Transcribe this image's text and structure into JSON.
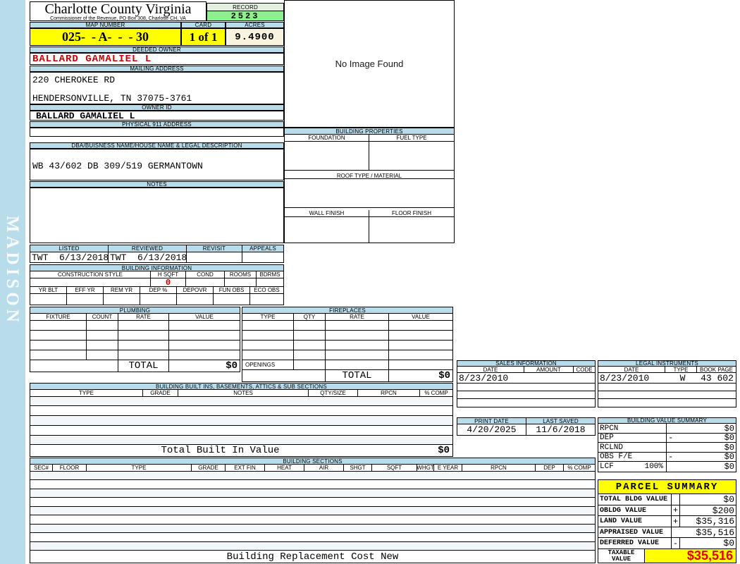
{
  "colors": {
    "header_bar_blue": "#b9dcea",
    "record_green": "#90ee90",
    "highlight_yellow": "#ffff00",
    "acres_cream": "#f7f3df",
    "alert_red": "#cc0000"
  },
  "watermark": "MADISON",
  "header": {
    "county": "Charlotte County Virginia",
    "commissioner": "Commissioner of the Revenue, PO Box 308, Charlotte CH, VA",
    "record_label": "RECORD",
    "record": "2523",
    "map_label": "MAP NUMBER",
    "map": "025-  - A-  -  - 30",
    "card_label": "CARD",
    "card": "1 of 1",
    "acres_label": "ACRES",
    "acres": "9.4900"
  },
  "image_box": {
    "text": "No Image Found"
  },
  "owner": {
    "deeded_label": "DEEDED OWNER",
    "deeded": "BALLARD GAMALIEL L",
    "mailing_label": "MAILING ADDRESS",
    "address1": "220 CHEROKEE RD",
    "address2": "HENDERSONVILLE, TN 37075-3761",
    "owner_id_label": "OWNER ID",
    "owner_id": "BALLARD GAMALIEL L",
    "physical_label": "PHYSICAL 911 ADDRESS",
    "physical": ""
  },
  "dba": {
    "label": "DBA/BUISNESS NAME/HOUSE NAME & LEGAL DESCRIPTION",
    "value": "WB 43/602 DB 309/519 GERMANTOWN"
  },
  "notes": {
    "label": "NOTES",
    "value": ""
  },
  "review": {
    "headers": [
      "LISTED",
      "REVIEWED",
      "REVISIT",
      "APPEALS"
    ],
    "values": [
      "TWT  6/13/2018",
      "TWT  6/13/2018",
      "",
      ""
    ]
  },
  "building_info": {
    "title": "BUILDING INFORMATION",
    "headers1": [
      "CONSTRUCTION STYLE",
      "H SQFT",
      "COND",
      "ROOMS",
      "BDRMS"
    ],
    "h_sqft": "0",
    "headers2": [
      "YR BLT",
      "EFF YR",
      "REM YR",
      "DEP %",
      "DEPOVR",
      "FUN OBS",
      "ECO OBS"
    ]
  },
  "building_properties": {
    "title": "BUILDING PROPERTIES",
    "foundation": "FOUNDATION",
    "fuel": "FUEL TYPE",
    "roof": "ROOF TYPE / MATERIAL",
    "wall": "WALL FINISH",
    "floor": "FLOOR FINISH"
  },
  "plumbing": {
    "title": "PLUMBING",
    "headers": [
      "FIXTURE",
      "COUNT",
      "RATE",
      "VALUE"
    ],
    "total_label": "TOTAL",
    "total": "$0"
  },
  "fireplaces": {
    "title": "FIREPLACES",
    "headers": [
      "TYPE",
      "QTY",
      "RATE",
      "VALUE"
    ],
    "openings_label": "OPENINGS",
    "total_label": "TOTAL",
    "total": "$0"
  },
  "built_ins": {
    "title": "BUILDING BUILT INS, BASEMENTS,  ATTICS & SUB SECTIONS",
    "headers": [
      "TYPE",
      "GRADE",
      "NOTES",
      "QTY/SIZE",
      "RPCN",
      "% COMP"
    ],
    "total_label": "Total Built In Value",
    "total": "$0"
  },
  "building_sections": {
    "title": "BUILDING SECTIONS",
    "headers": [
      "SEC#",
      "FLOOR",
      "TYPE",
      "GRADE",
      "EXT FIN",
      "HEAT",
      "AIR",
      "SHGT",
      "SQFT",
      "WHGT",
      "E YEAR",
      "RPCN",
      "DEP",
      "% COMP"
    ],
    "footer": "Building Replacement Cost New"
  },
  "sales": {
    "title": "SALES INFORMATION",
    "headers": [
      "DATE",
      "AMOUNT",
      "CODE"
    ],
    "rows": [
      [
        "8/23/2010",
        "",
        ""
      ]
    ]
  },
  "legal_instruments": {
    "title": "LEGAL INSTRUMENTS",
    "headers": [
      "DATE",
      "TYPE",
      "BOOK PAGE"
    ],
    "rows": [
      [
        "8/23/2010",
        "W",
        "43 602"
      ]
    ]
  },
  "dates": {
    "print_label": "PRINT DATE",
    "print": "4/20/2025",
    "saved_label": "LAST SAVED",
    "saved": "11/6/2018"
  },
  "building_value_summary": {
    "title": "BUILDING VALUE SUMMARY",
    "rows": [
      {
        "label": "RPCN",
        "pct": "",
        "op": "",
        "value": "$0"
      },
      {
        "label": "DEP",
        "pct": "",
        "op": "-",
        "value": "$0"
      },
      {
        "label": "RCLND",
        "pct": "",
        "op": "",
        "value": "$0"
      },
      {
        "label": "OBS F/E",
        "pct": "",
        "op": "-",
        "value": "$0"
      },
      {
        "label": "LCF",
        "pct": "100%",
        "op": "",
        "value": "$0"
      }
    ]
  },
  "parcel_summary": {
    "title": "PARCEL SUMMARY",
    "rows": [
      {
        "label": "TOTAL BLDG VALUE",
        "op": "",
        "value": "$0"
      },
      {
        "label": "OBLDG VALUE",
        "op": "+",
        "value": "$200"
      },
      {
        "label": "LAND VALUE",
        "op": "+",
        "value": "$35,316"
      },
      {
        "label": "APPRAISED VALUE",
        "op": "",
        "value": "$35,516"
      },
      {
        "label": "DEFERRED VALUE",
        "op": "-",
        "value": "$0"
      }
    ],
    "taxable_label": "TAXABLE VALUE",
    "taxable": "$35,516"
  }
}
